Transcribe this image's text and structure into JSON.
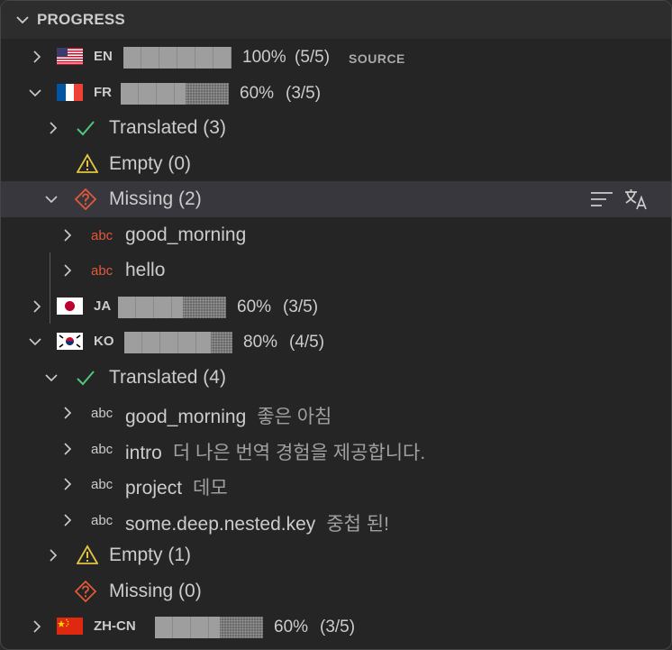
{
  "header": {
    "title": "PROGRESS"
  },
  "languages": [
    {
      "code": "EN",
      "flag": "us-flag-icon",
      "percent_text": "100%",
      "count_text": "(5/5)",
      "progress": 1.0,
      "source_label": "SOURCE"
    },
    {
      "code": "FR",
      "flag": "fr-flag-icon",
      "percent_text": "60%",
      "count_text": "(3/5)",
      "progress": 0.6
    },
    {
      "code": "JA",
      "flag": "jp-flag-icon",
      "percent_text": "60%",
      "count_text": "(3/5)",
      "progress": 0.6
    },
    {
      "code": "KO",
      "flag": "kr-flag-icon",
      "percent_text": "80%",
      "count_text": "(4/5)",
      "progress": 0.8
    },
    {
      "code": "ZH-CN",
      "flag": "cn-flag-icon",
      "percent_text": "60%",
      "count_text": "(3/5)",
      "progress": 0.6
    }
  ],
  "fr": {
    "translated": "Translated (3)",
    "empty": "Empty (0)",
    "missing": "Missing (2)",
    "missing_keys": [
      "good_morning",
      "hello"
    ]
  },
  "ko": {
    "translated": "Translated (4)",
    "keys": [
      {
        "key": "good_morning",
        "value": "좋은 아침"
      },
      {
        "key": "intro",
        "value": "더 나은 번역 경험을 제공합니다."
      },
      {
        "key": "project",
        "value": "데모"
      },
      {
        "key": "some.deep.nested.key",
        "value": "중첩 된!"
      }
    ],
    "empty": "Empty (1)",
    "missing": "Missing (0)"
  },
  "abc_label": "abc",
  "colors": {
    "check": "#4ec97a",
    "warning": "#e2c541",
    "missing": "#e05a3a"
  }
}
